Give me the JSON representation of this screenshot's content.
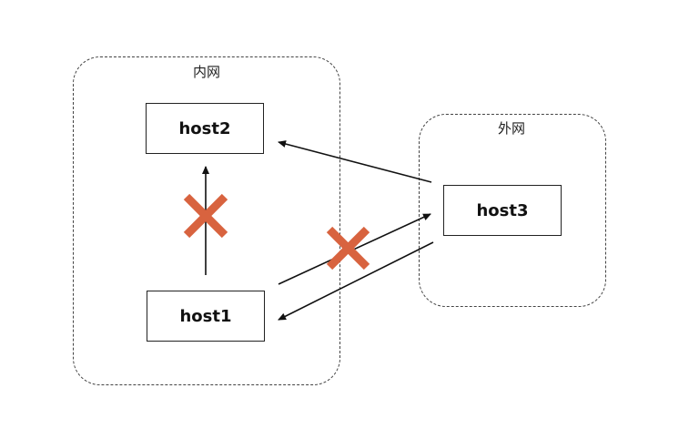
{
  "zones": {
    "intranet": {
      "label": "内网"
    },
    "extranet": {
      "label": "外网"
    }
  },
  "hosts": {
    "host1": {
      "label": "host1"
    },
    "host2": {
      "label": "host2"
    },
    "host3": {
      "label": "host3"
    }
  },
  "connections": [
    {
      "from": "host1",
      "to": "host2",
      "blocked": true
    },
    {
      "from": "host1",
      "to": "host3",
      "blocked": true
    },
    {
      "from": "host3",
      "to": "host2",
      "blocked": false
    },
    {
      "from": "host3",
      "to": "host1",
      "blocked": false
    }
  ],
  "colors": {
    "line": "#111111",
    "block_mark": "#d8633f",
    "zone_border": "#444444"
  }
}
